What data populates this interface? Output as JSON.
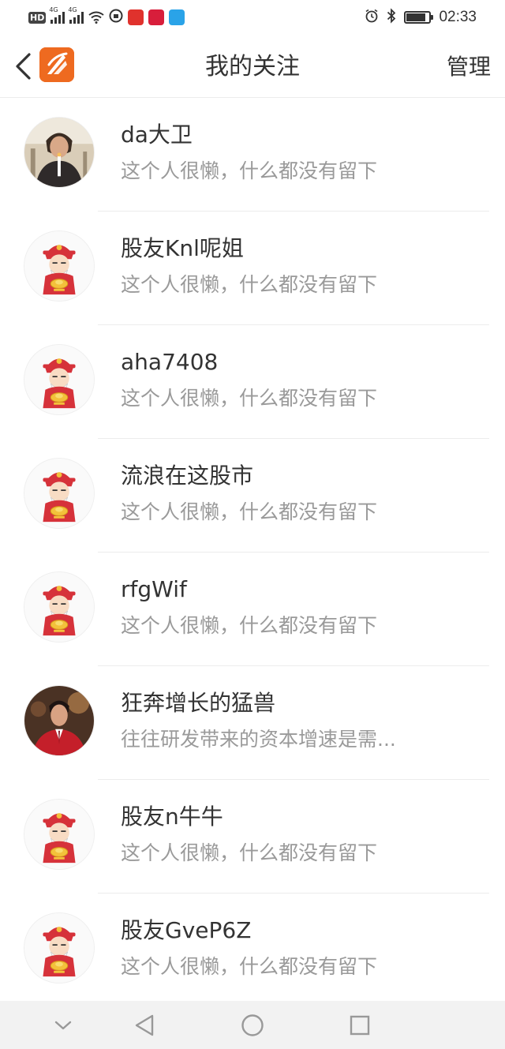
{
  "status_bar": {
    "time": "02:33",
    "battery_level": 0.85,
    "icons": [
      "hd-icon",
      "signal-4g-icon",
      "signal-4g-icon",
      "wifi-icon",
      "vpn-icon",
      "app-notification-icon",
      "app-notification-icon",
      "app-notification-icon",
      "alarm-icon",
      "bluetooth-icon",
      "battery-icon"
    ]
  },
  "header": {
    "title": "我的关注",
    "manage_label": "管理",
    "back_icon": "chevron-left-icon",
    "logo_icon": "app-logo-icon",
    "accent_color": "#ee6a20"
  },
  "following": [
    {
      "name": "da大卫",
      "bio": "这个人很懒，什么都没有留下",
      "avatar": "photo-man-candle"
    },
    {
      "name": "股友Knl呢姐",
      "bio": "这个人很懒，什么都没有留下",
      "avatar": "default-fortune-god"
    },
    {
      "name": "aha7408",
      "bio": "这个人很懒，什么都没有留下",
      "avatar": "default-fortune-god"
    },
    {
      "name": "流浪在这股市",
      "bio": "这个人很懒，什么都没有留下",
      "avatar": "default-fortune-god"
    },
    {
      "name": "rfgWif",
      "bio": "这个人很懒，什么都没有留下",
      "avatar": "default-fortune-god"
    },
    {
      "name": "狂奔增长的猛兽",
      "bio": "往往研发带来的资本增速是需...",
      "avatar": "photo-man-red-suit"
    },
    {
      "name": "股友n牛牛",
      "bio": "这个人很懒，什么都没有留下",
      "avatar": "default-fortune-god"
    },
    {
      "name": "股友GveP6Z",
      "bio": "这个人很懒，什么都没有留下",
      "avatar": "default-fortune-god"
    }
  ],
  "nav": {
    "icons": [
      "chevron-down-icon",
      "back-triangle-icon",
      "home-circle-icon",
      "recents-square-icon"
    ]
  }
}
